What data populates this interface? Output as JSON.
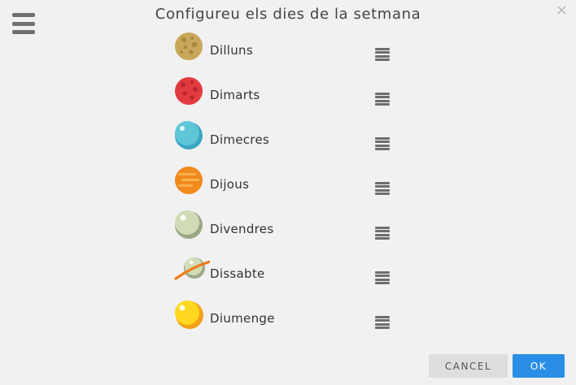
{
  "dialog": {
    "title": "Configureu els dies de la setmana",
    "close_glyph": "×"
  },
  "days": [
    {
      "label": "Dilluns",
      "icon": "moon-icon"
    },
    {
      "label": "Dimarts",
      "icon": "mars-icon"
    },
    {
      "label": "Dimecres",
      "icon": "mercury-icon"
    },
    {
      "label": "Dijous",
      "icon": "jupiter-icon"
    },
    {
      "label": "Divendres",
      "icon": "venus-icon"
    },
    {
      "label": "Dissabte",
      "icon": "saturn-icon"
    },
    {
      "label": "Diumenge",
      "icon": "sun-icon"
    }
  ],
  "buttons": {
    "cancel": "CANCEL",
    "ok": "OK"
  },
  "colors": {
    "ok_button": "#2b8ee6",
    "cancel_button": "#dedede",
    "background": "#f1f1f1"
  }
}
